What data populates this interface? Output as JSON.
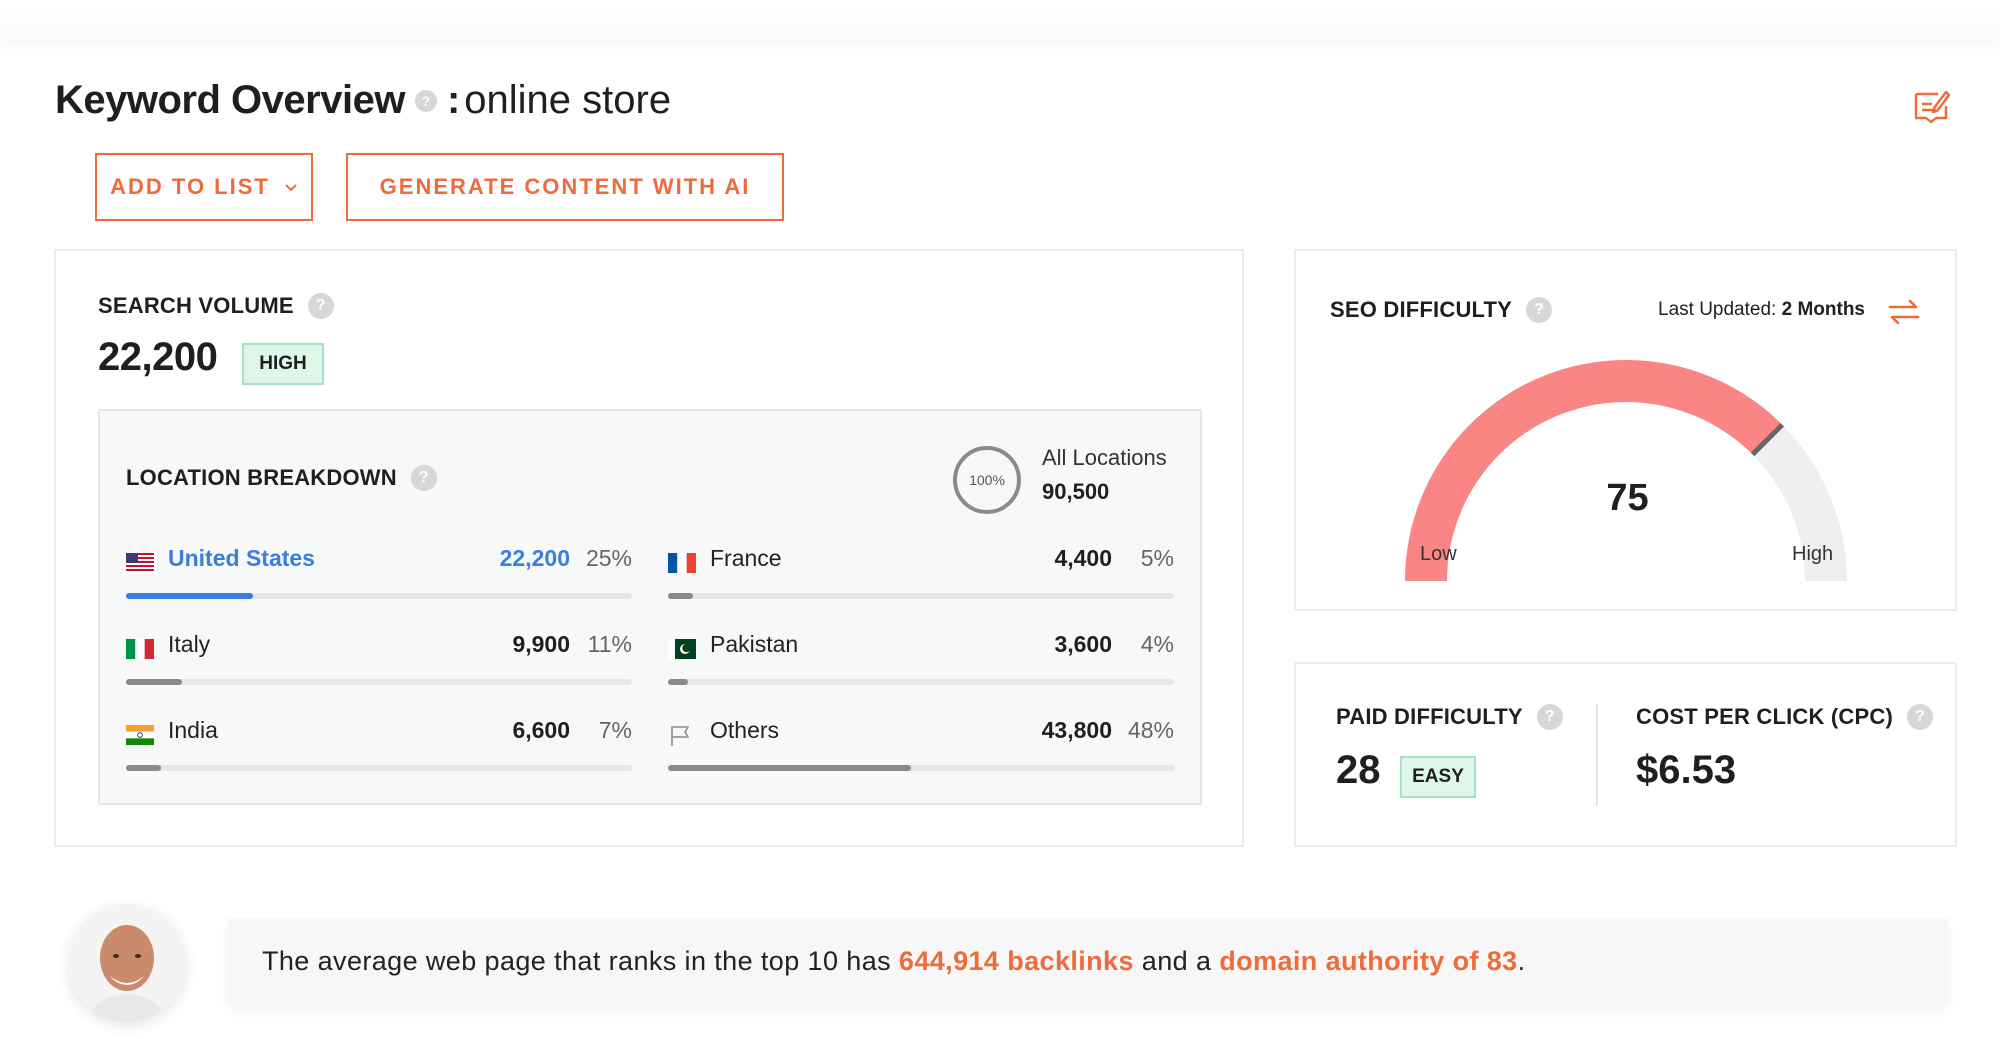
{
  "header": {
    "title": "Keyword Overview",
    "separator": ":",
    "keyword": "online store"
  },
  "actions": {
    "add_to_list": "ADD TO LIST",
    "generate": "GENERATE CONTENT WITH AI"
  },
  "search_volume": {
    "label": "SEARCH VOLUME",
    "value": "22,200",
    "badge": "HIGH"
  },
  "location_breakdown": {
    "label": "LOCATION BREAKDOWN",
    "ring_label": "100%",
    "all_label": "All Locations",
    "all_value": "90,500",
    "rows": [
      {
        "name": "United States",
        "value": "22,200",
        "pct": "25%",
        "fraction": 0.25,
        "flag": "us-flag",
        "active": true
      },
      {
        "name": "France",
        "value": "4,400",
        "pct": "5%",
        "fraction": 0.05,
        "flag": "fr-flag",
        "active": false
      },
      {
        "name": "Italy",
        "value": "9,900",
        "pct": "11%",
        "fraction": 0.11,
        "flag": "it-flag",
        "active": false
      },
      {
        "name": "Pakistan",
        "value": "3,600",
        "pct": "4%",
        "fraction": 0.04,
        "flag": "pk-flag",
        "active": false
      },
      {
        "name": "India",
        "value": "6,600",
        "pct": "7%",
        "fraction": 0.07,
        "flag": "in-flag",
        "active": false
      },
      {
        "name": "Others",
        "value": "43,800",
        "pct": "48%",
        "fraction": 0.48,
        "flag": "flag-outline-icon",
        "active": false
      }
    ]
  },
  "seo_difficulty": {
    "label": "SEO DIFFICULTY",
    "last_updated_label": "Last Updated:",
    "last_updated_value": "2 Months",
    "value": "75",
    "gauge_fraction": 0.75,
    "low_label": "Low",
    "high_label": "High"
  },
  "paid_difficulty": {
    "label": "PAID DIFFICULTY",
    "value": "28",
    "badge": "EASY"
  },
  "cpc": {
    "label": "COST PER CLICK (CPC)",
    "value": "$6.53"
  },
  "tip": {
    "prefix": "The average web page that ranks in the top 10 has ",
    "backlinks": "644,914 backlinks",
    "middle": " and a ",
    "authority": "domain authority of 83",
    "suffix": "."
  },
  "colors": {
    "accent": "#ef6b3b",
    "active_blue": "#3b7de0",
    "gauge_fill": "#f98585",
    "gauge_track": "#eef0f0",
    "badge_bg": "#dff6ea"
  }
}
